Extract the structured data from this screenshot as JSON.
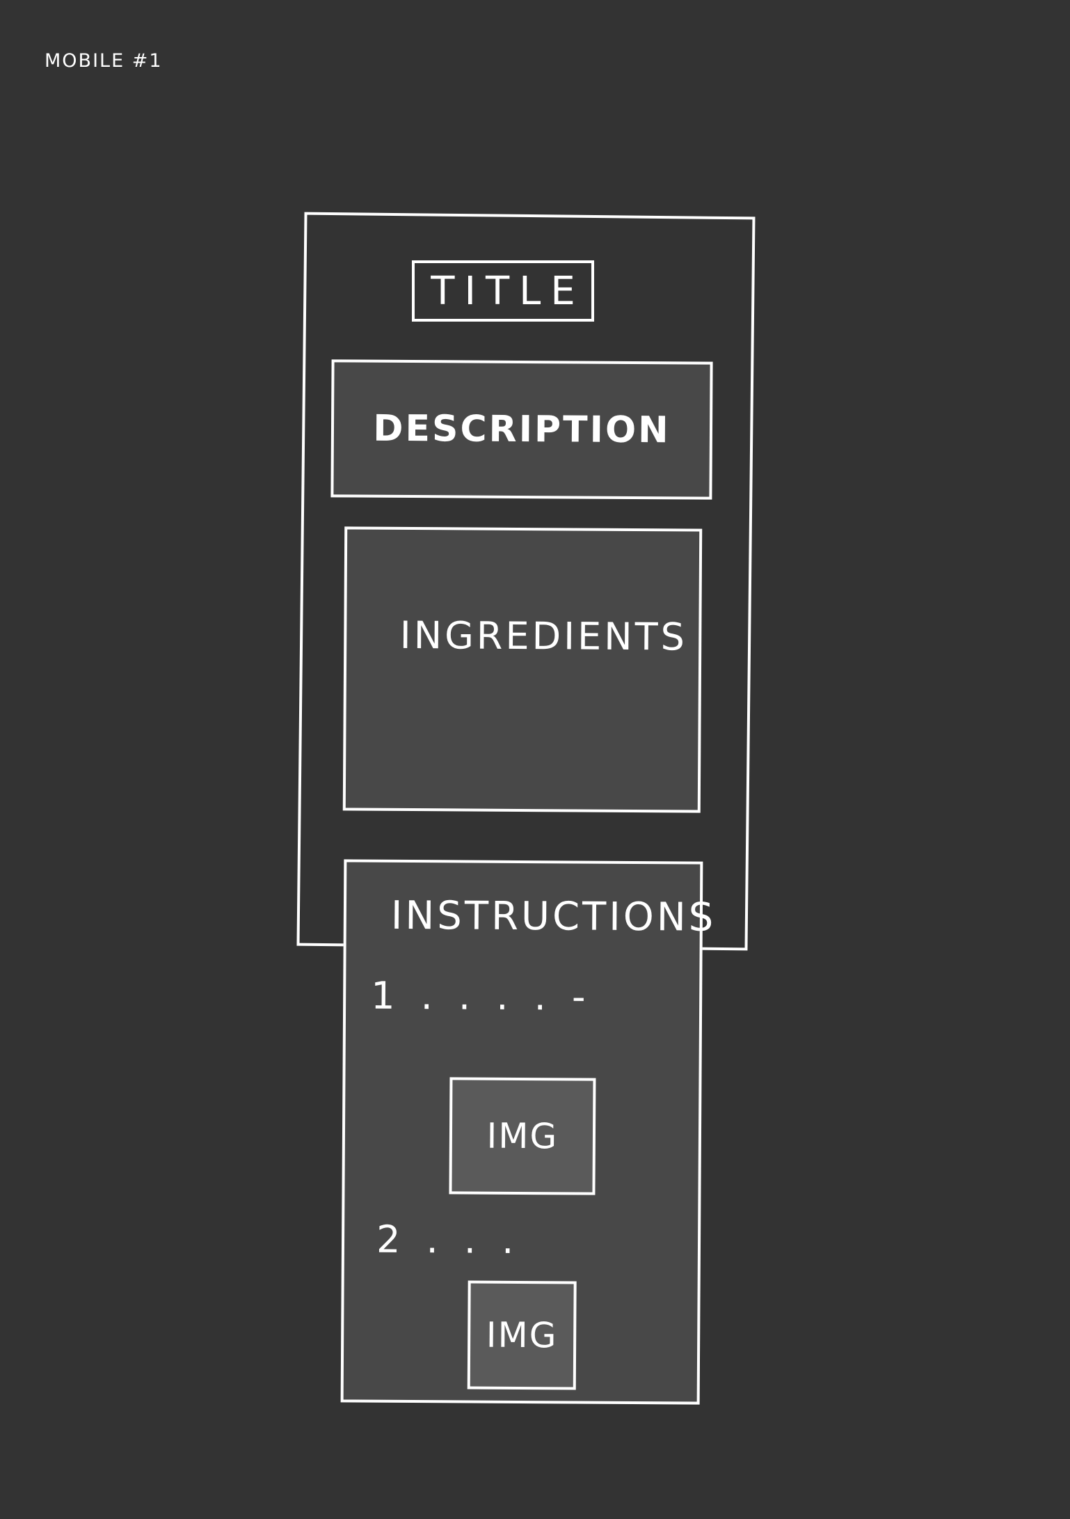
{
  "sketch_label": "MOBILE #1",
  "wireframe": {
    "title": "TITLE",
    "description": "DESCRIPTION",
    "ingredients": "INGREDIENTS",
    "instructions": {
      "heading": "INSTRUCTIONS",
      "steps": [
        {
          "number_text": "1 . . . . -",
          "image_label": "IMG"
        },
        {
          "number_text": "2 . . .",
          "image_label": "IMG"
        }
      ]
    }
  }
}
